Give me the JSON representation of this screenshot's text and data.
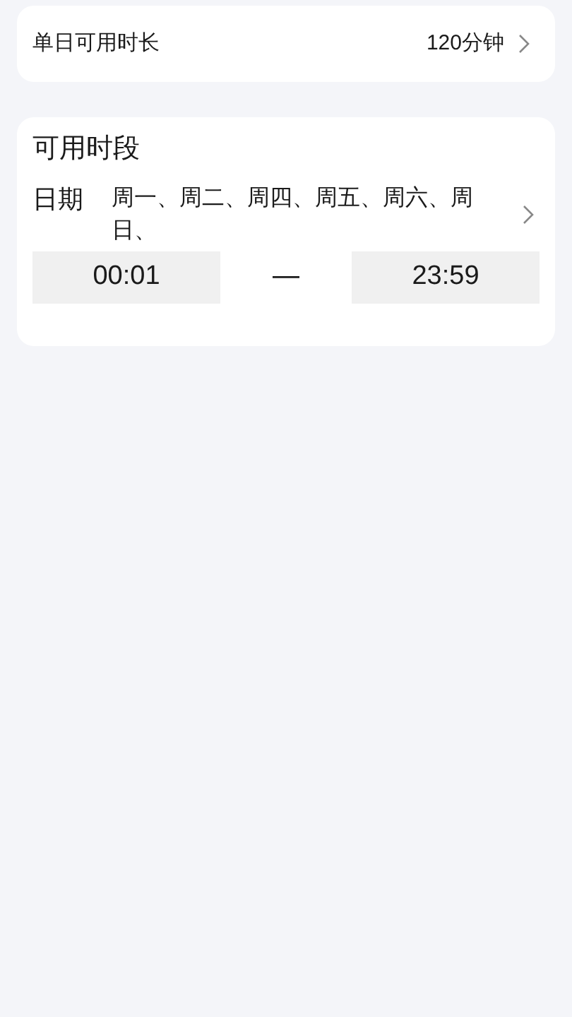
{
  "daily_limit": {
    "label": "单日可用时长",
    "value": "120分钟"
  },
  "periods": {
    "title": "可用时段",
    "date_label": "日期",
    "days": "周一、周二、周四、周五、周六、周日、",
    "start": "00:01",
    "separator": "—",
    "end": "23:59"
  }
}
